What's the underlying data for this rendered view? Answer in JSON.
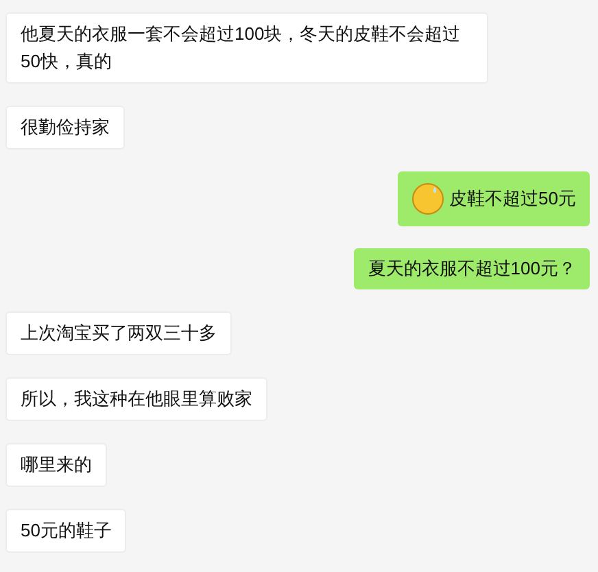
{
  "messages": [
    {
      "kind": "received",
      "emoji": false,
      "text": "他夏天的衣服一套不会超过100块，冬天的皮鞋不会超过50快，真的"
    },
    {
      "kind": "received",
      "emoji": false,
      "text": "很勤俭持家"
    },
    {
      "kind": "sent",
      "emoji": true,
      "text": "皮鞋不超过50元"
    },
    {
      "kind": "sent",
      "emoji": false,
      "text": "夏天的衣服不超过100元？"
    },
    {
      "kind": "received",
      "emoji": false,
      "text": "上次淘宝买了两双三十多"
    },
    {
      "kind": "received",
      "emoji": false,
      "text": "所以，我这种在他眼里算败家"
    },
    {
      "kind": "received",
      "emoji": false,
      "text": "哪里来的"
    },
    {
      "kind": "received",
      "emoji": false,
      "text": "50元的鞋子"
    }
  ]
}
